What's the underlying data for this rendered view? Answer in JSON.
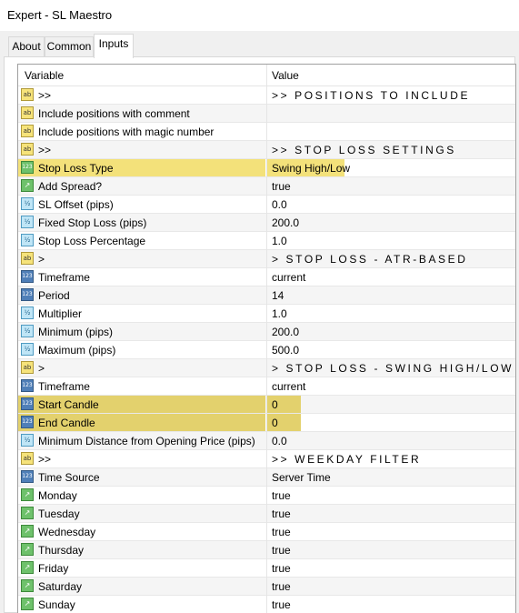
{
  "window": {
    "title": "Expert - SL Maestro"
  },
  "tabs": [
    {
      "label": "About"
    },
    {
      "label": "Common"
    },
    {
      "label": "Inputs"
    }
  ],
  "grid": {
    "header": {
      "variable": "Variable",
      "value": "Value"
    },
    "rows": [
      {
        "icon": "ab",
        "name": ">>",
        "value": ">> POSITIONS TO INCLUDE",
        "section": true
      },
      {
        "icon": "ab",
        "name": "Include positions with comment",
        "value": ""
      },
      {
        "icon": "ab",
        "name": "Include positions with magic number",
        "value": ""
      },
      {
        "icon": "ab",
        "name": ">>",
        "value": ">> STOP LOSS SETTINGS",
        "section": true
      },
      {
        "icon": "enum",
        "name": "Stop Loss Type",
        "value": "Swing High/Low",
        "highlight": true
      },
      {
        "icon": "bool",
        "name": "Add Spread?",
        "value": "true"
      },
      {
        "icon": "double",
        "name": "SL Offset (pips)",
        "value": "0.0"
      },
      {
        "icon": "double",
        "name": "Fixed Stop Loss (pips)",
        "value": "200.0"
      },
      {
        "icon": "double",
        "name": "Stop Loss Percentage",
        "value": "1.0"
      },
      {
        "icon": "ab",
        "name": ">",
        "value": "> STOP LOSS - ATR-BASED",
        "section": true
      },
      {
        "icon": "int",
        "name": "Timeframe",
        "value": "current"
      },
      {
        "icon": "int",
        "name": "Period",
        "value": "14"
      },
      {
        "icon": "double",
        "name": "Multiplier",
        "value": "1.0"
      },
      {
        "icon": "double",
        "name": "Minimum (pips)",
        "value": "200.0"
      },
      {
        "icon": "double",
        "name": "Maximum (pips)",
        "value": "500.0"
      },
      {
        "icon": "ab",
        "name": ">",
        "value": "> STOP LOSS - SWING HIGH/LOW",
        "section": true
      },
      {
        "icon": "int",
        "name": "Timeframe",
        "value": "current"
      },
      {
        "icon": "int",
        "name": "Start Candle",
        "value": "0",
        "highlight": true
      },
      {
        "icon": "int",
        "name": "End Candle",
        "value": "0",
        "highlight": true
      },
      {
        "icon": "double",
        "name": "Minimum Distance from Opening Price (pips)",
        "value": "0.0"
      },
      {
        "icon": "ab",
        "name": ">>",
        "value": ">> WEEKDAY FILTER",
        "section": true
      },
      {
        "icon": "int",
        "name": "Time Source",
        "value": "Server Time"
      },
      {
        "icon": "bool",
        "name": "Monday",
        "value": "true"
      },
      {
        "icon": "bool",
        "name": "Tuesday",
        "value": "true"
      },
      {
        "icon": "bool",
        "name": "Wednesday",
        "value": "true"
      },
      {
        "icon": "bool",
        "name": "Thursday",
        "value": "true"
      },
      {
        "icon": "bool",
        "name": "Friday",
        "value": "true"
      },
      {
        "icon": "bool",
        "name": "Saturday",
        "value": "true"
      },
      {
        "icon": "bool",
        "name": "Sunday",
        "value": "true"
      }
    ]
  },
  "colors": {
    "highlight": "#f3e17a",
    "highlight_strong": "#e3d16d",
    "row_alt": "#f5f5f5"
  }
}
